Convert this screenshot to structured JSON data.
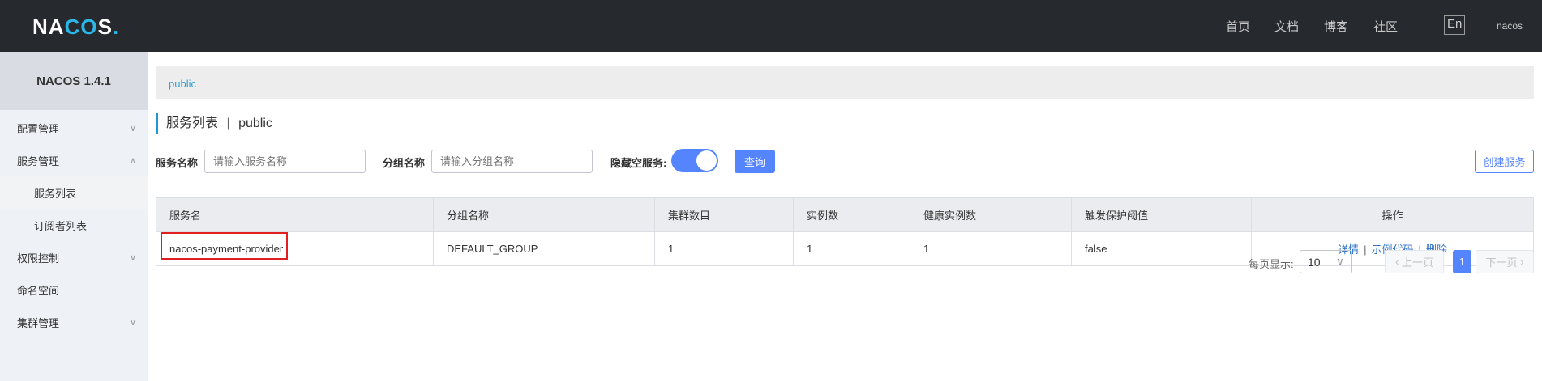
{
  "header": {
    "logo": "NACOS.",
    "nav": [
      "首页",
      "文档",
      "博客",
      "社区"
    ],
    "lang": "En",
    "user": "nacos"
  },
  "sidebar": {
    "title": "NACOS 1.4.1",
    "items": [
      {
        "label": "配置管理",
        "chevron": "down"
      },
      {
        "label": "服务管理",
        "chevron": "up"
      },
      {
        "label": "服务列表"
      },
      {
        "label": "订阅者列表"
      },
      {
        "label": "权限控制",
        "chevron": "down"
      },
      {
        "label": "命名空间"
      },
      {
        "label": "集群管理",
        "chevron": "down"
      }
    ]
  },
  "breadcrumb": "public",
  "page": {
    "title": "服务列表",
    "sep": "|",
    "namespace": "public"
  },
  "filters": {
    "service_label": "服务名称",
    "service_placeholder": "请输入服务名称",
    "group_label": "分组名称",
    "group_placeholder": "请输入分组名称",
    "hide_empty_label": "隐藏空服务:",
    "hide_empty": true,
    "query": "查询",
    "create": "创建服务"
  },
  "table": {
    "headers": [
      "服务名",
      "分组名称",
      "集群数目",
      "实例数",
      "健康实例数",
      "触发保护阈值",
      "操作"
    ],
    "rows": [
      {
        "name": "nacos-payment-provider",
        "group": "DEFAULT_GROUP",
        "clusters": "1",
        "instances": "1",
        "healthy": "1",
        "threshold": "false",
        "actions": [
          "详情",
          "示例代码",
          "删除"
        ]
      }
    ]
  },
  "pagination": {
    "per_page_label": "每页显示:",
    "per_page": "10",
    "prev": "上一页",
    "current": "1",
    "next": "下一页"
  },
  "colors": {
    "accent": "#5584ff",
    "header": "#262a2f",
    "highlight": "#e02020"
  }
}
